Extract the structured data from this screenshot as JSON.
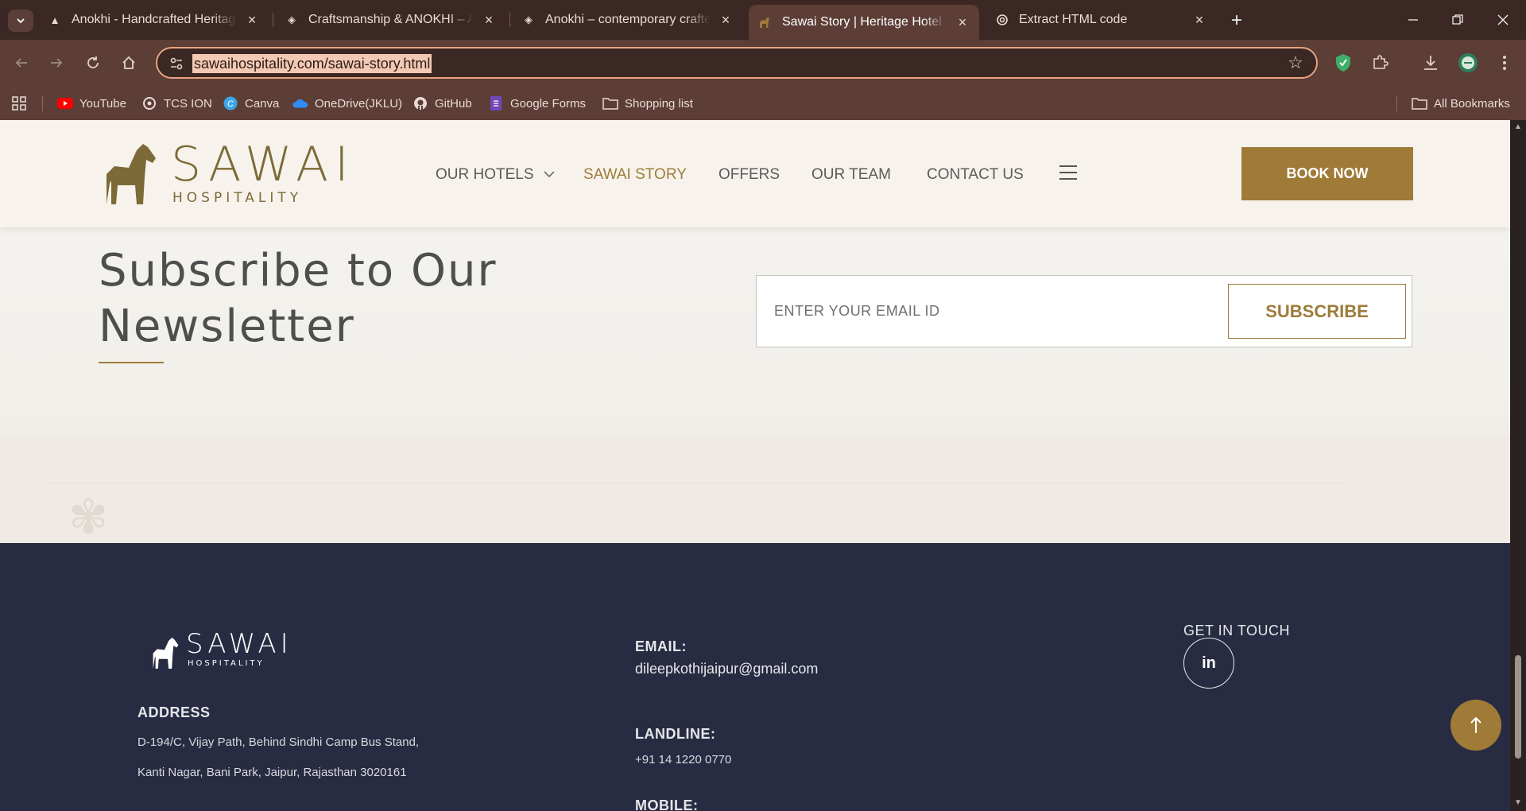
{
  "browser": {
    "tabs": [
      {
        "title": "Anokhi - Handcrafted Heritage,",
        "favicon": "anokhi-a-icon"
      },
      {
        "title": "Craftsmanship & ANOKHI – An",
        "favicon": "elephant-icon"
      },
      {
        "title": "Anokhi – contemporary crafted",
        "favicon": "elephant-icon"
      },
      {
        "title": "Sawai Story | Heritage Hotel in I",
        "favicon": "horse-icon",
        "active": true
      },
      {
        "title": "Extract HTML code",
        "favicon": "openai-icon"
      }
    ],
    "url": "sawaihospitality.com/sawai-story.html",
    "bookmarks": [
      {
        "label": "YouTube",
        "icon": "youtube-icon"
      },
      {
        "label": "TCS ION",
        "icon": "tcs-icon"
      },
      {
        "label": "Canva",
        "icon": "canva-icon"
      },
      {
        "label": "OneDrive(JKLU)",
        "icon": "onedrive-icon"
      },
      {
        "label": "GitHub",
        "icon": "github-icon"
      },
      {
        "label": "Google Forms",
        "icon": "forms-icon"
      },
      {
        "label": "Shopping list",
        "icon": "folder-icon"
      }
    ],
    "all_bookmarks": "All Bookmarks"
  },
  "site": {
    "logo": {
      "word": "SAWAI",
      "sub": "HOSPITALITY"
    },
    "nav": {
      "hotels": "OUR HOTELS",
      "story": "SAWAI STORY",
      "offers": "OFFERS",
      "team": "OUR TEAM",
      "contact": "CONTACT US"
    },
    "book_now": "BOOK NOW",
    "accent": "#a07a37"
  },
  "newsletter": {
    "title_line1": "Subscribe to Our",
    "title_line2": "Newsletter",
    "email_placeholder": "ENTER YOUR EMAIL ID",
    "subscribe": "SUBSCRIBE"
  },
  "footer": {
    "logo": {
      "word": "SAWAI",
      "sub": "HOSPITALITY"
    },
    "address_label": "ADDRESS",
    "address_line1": "D-194/C, Vijay Path, Behind Sindhi Camp Bus Stand,",
    "address_line2": "Kanti Nagar, Bani Park, Jaipur, Rajasthan 3020161",
    "email_label": "EMAIL:",
    "email": "dileepkothijaipur@gmail.com",
    "landline_label": "LANDLINE:",
    "landline": "+91 14 1220 0770",
    "mobile_label": "MOBILE:",
    "get_in_touch": "GET IN TOUCH",
    "linkedin": "in",
    "background": "#282c42"
  }
}
